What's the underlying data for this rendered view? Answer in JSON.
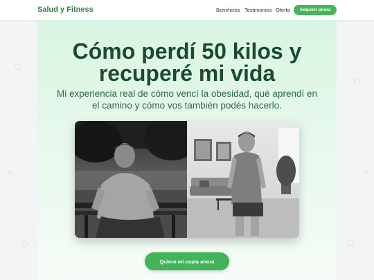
{
  "brand": {
    "name": "Salud y Fitness"
  },
  "nav": {
    "links": [
      {
        "label": "Beneficios"
      },
      {
        "label": "Testimonios"
      },
      {
        "label": "Oferta"
      }
    ],
    "cta_label": "Adquirir ahora"
  },
  "hero": {
    "headline_line1": "Cómo perdí 50 kilos y",
    "headline_line2": "recuperé mi vida",
    "subtitle_line1": "Mi experiencia real de cómo vencí la obesidad, qué aprendí en",
    "subtitle_line2": "el camino y cómo vos también podés hacerlo.",
    "image": {
      "left": "before-photo-man-on-park-bench",
      "right": "after-photo-man-in-living-room",
      "style": "black-and-white"
    },
    "cta_label": "Quiero mi copia ahora"
  },
  "colors": {
    "brand_green": "#2e7d3e",
    "button_green": "#46b55a",
    "hero_bg": "#d9f5e2",
    "headline": "#1c4a2e"
  }
}
